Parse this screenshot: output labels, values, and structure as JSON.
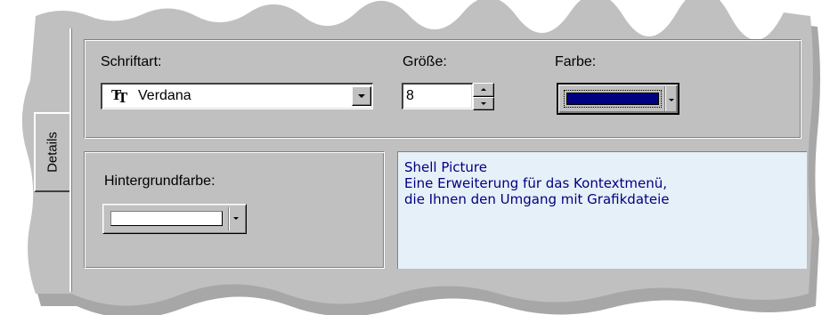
{
  "side_tab": {
    "label": "Details"
  },
  "font": {
    "label": "Schriftart:",
    "value": "Verdana",
    "icon": "truetype-font-icon"
  },
  "size": {
    "label": "Größe:",
    "value": "8"
  },
  "color": {
    "label": "Farbe:",
    "swatch": "#000080"
  },
  "background": {
    "label": "Hintergrundfarbe:",
    "swatch": "#ffffff"
  },
  "preview": {
    "lines": [
      "Shell Picture",
      "Eine Erweiterung für das Kontextmenü,",
      "die Ihnen den Umgang mit Grafikdateie"
    ],
    "text_color": "#000080",
    "background_color": "#e6f0f8"
  },
  "colors": {
    "face": "#c0c0c0",
    "highlight": "#ffffff",
    "shadow": "#808080"
  }
}
